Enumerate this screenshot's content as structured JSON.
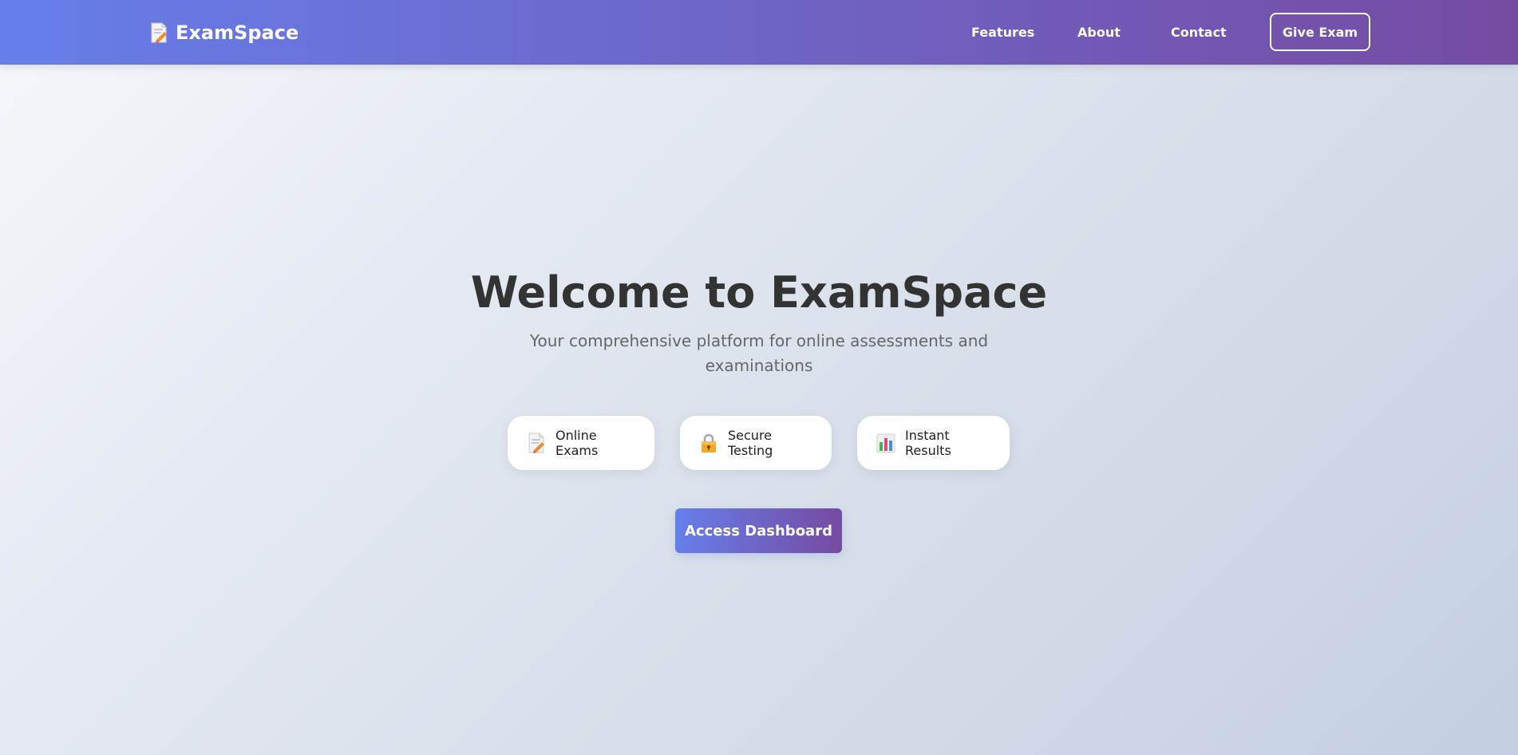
{
  "navbar": {
    "brand": {
      "icon": "memo-icon",
      "name": "ExamSpace"
    },
    "links": [
      {
        "label": "Features"
      },
      {
        "label": "About"
      },
      {
        "label": "Contact"
      }
    ],
    "cta_label": "Give Exam"
  },
  "hero": {
    "title": "Welcome to ExamSpace",
    "subtitle": "Your comprehensive platform for online assessments and examinations"
  },
  "features": [
    {
      "icon": "memo-icon",
      "label": "Online Exams"
    },
    {
      "icon": "lock-icon",
      "label": "Secure Testing"
    },
    {
      "icon": "bar-chart-icon",
      "label": "Instant Results"
    }
  ],
  "dashboard_button_label": "Access Dashboard",
  "colors": {
    "accent_start": "#667eea",
    "accent_end": "#764ba2",
    "title_text": "#333333",
    "subtitle_text": "#666666"
  }
}
